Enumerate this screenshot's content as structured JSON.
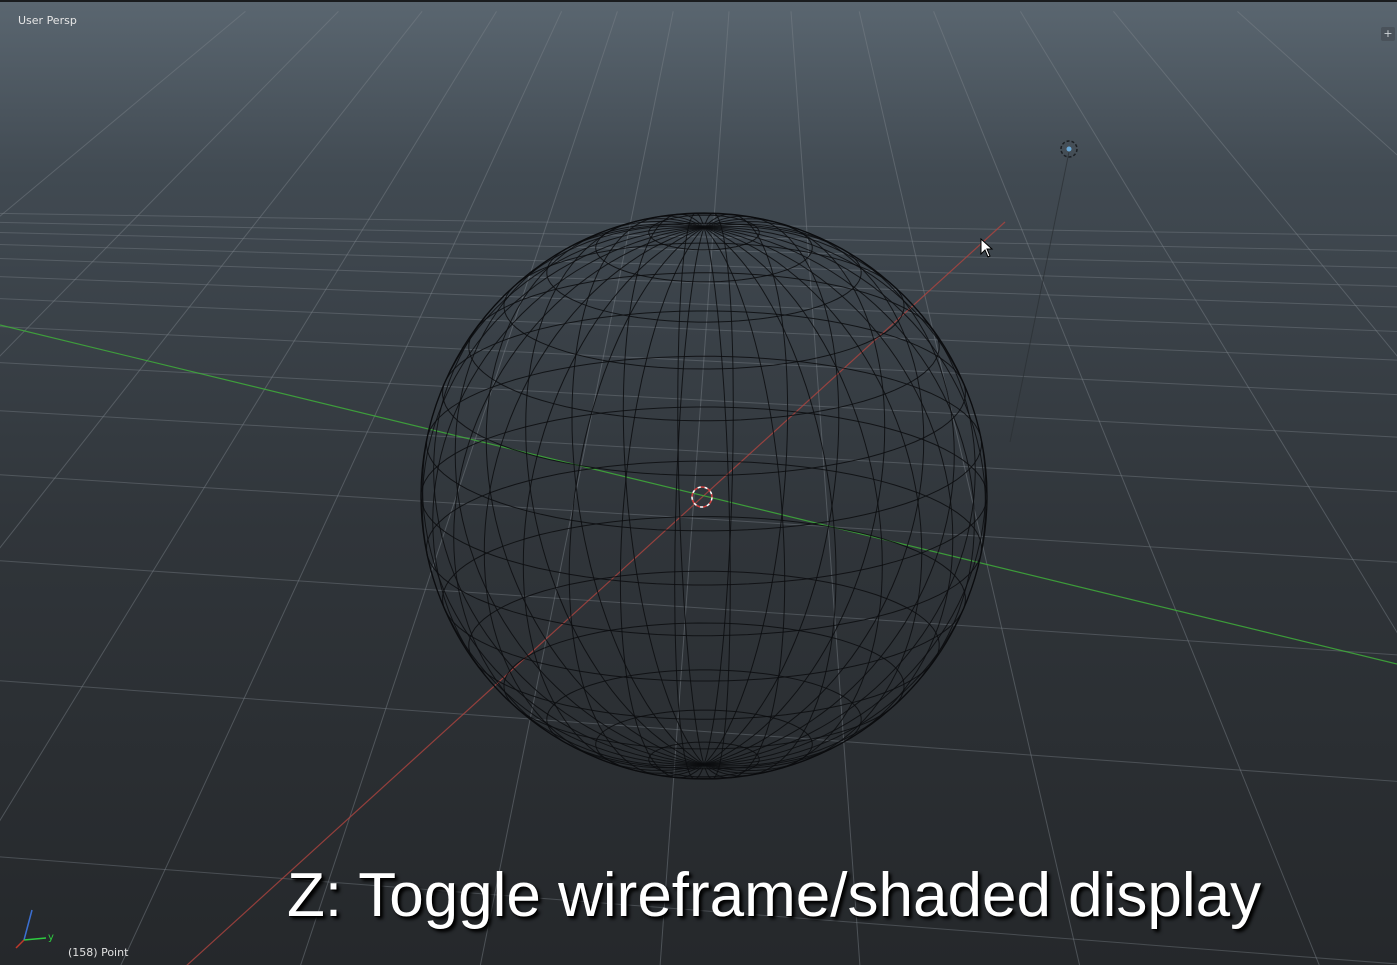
{
  "viewport": {
    "view_label": "User Persp",
    "status_text": "(158) Point",
    "caption": "Z: Toggle wireframe/shaded display",
    "mesh": "uv-sphere-wireframe",
    "display_mode": "wireframe"
  },
  "gizmo": {
    "y_label": "y",
    "x_color": "#c0392b",
    "y_color": "#2ecc40",
    "z_color": "#3b6fd1"
  },
  "icons": {
    "view_toggle": "plus-icon",
    "lamp": "lamp-icon",
    "cursor": "3d-cursor-icon",
    "mouse": "mouse-pointer-icon"
  },
  "colors": {
    "grid": "#7d848b",
    "x_axis": "#b0443f",
    "y_axis": "#3fae3a",
    "wire": "#0c0d0f"
  }
}
